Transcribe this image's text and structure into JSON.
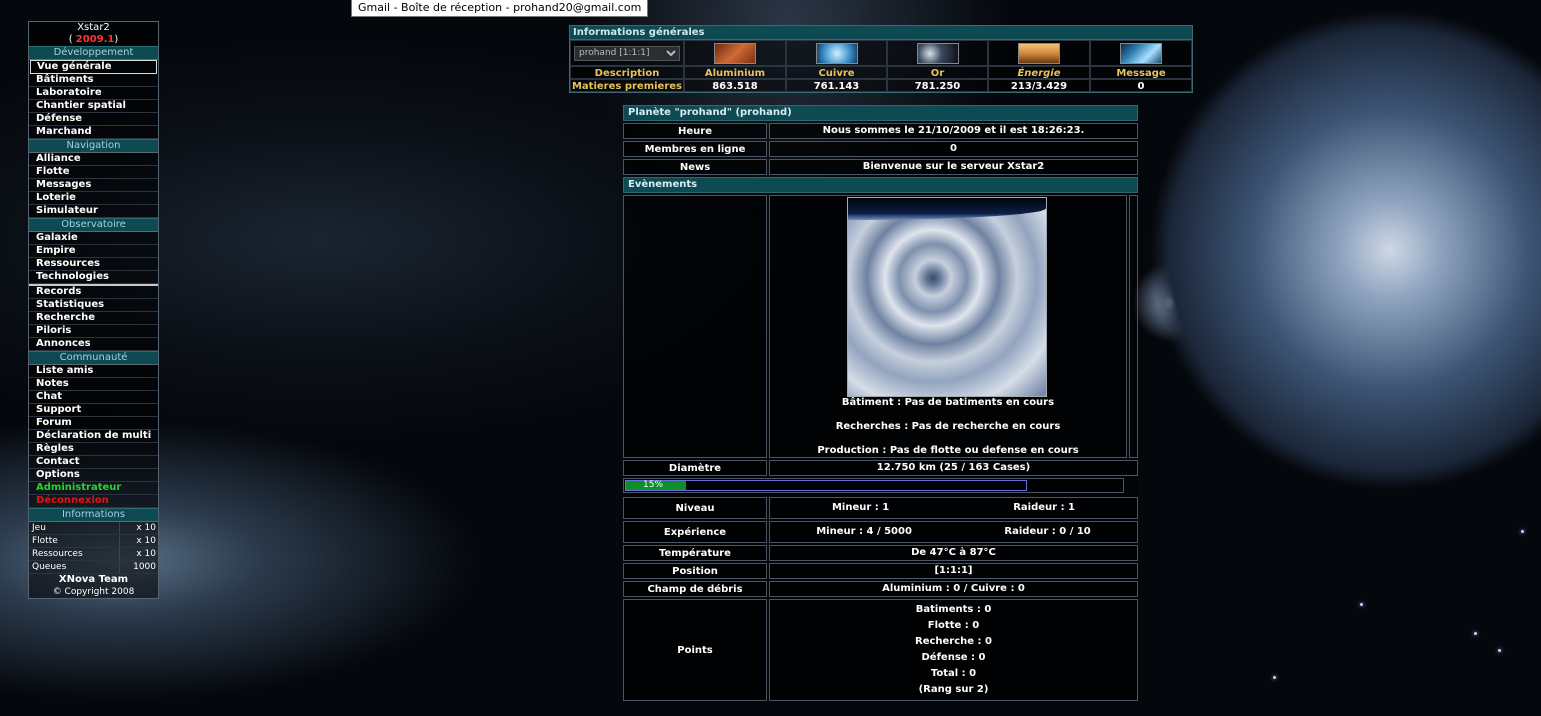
{
  "tooltip": "Gmail - Boîte de réception - prohand20@gmail.com",
  "menu": {
    "server": "Xstar2",
    "version_open": "(",
    "version": "2009.1",
    "version_close": ")",
    "sections": {
      "dev": "Développement",
      "nav": "Navigation",
      "obs": "Observatoire",
      "comm": "Communauté",
      "info": "Informations"
    },
    "dev_items": [
      "Vue générale",
      "Bâtiments",
      "Laboratoire",
      "Chantier spatial",
      "Défense",
      "Marchand"
    ],
    "nav_items": [
      "Alliance",
      "Flotte",
      "Messages",
      "Loterie",
      "Simulateur"
    ],
    "obs_items": [
      "Galaxie",
      "Empire",
      "Ressources",
      "Technologies"
    ],
    "misc_items": [
      "Records",
      "Statistiques",
      "Recherche",
      "Piloris",
      "Annonces"
    ],
    "comm_items": [
      "Liste amis",
      "Notes",
      "Chat",
      "Support",
      "Forum",
      "Déclaration de multi",
      "Règles",
      "Contact",
      "Options"
    ],
    "admin": "Administrateur",
    "logout": "Déconnexion",
    "info_rows": [
      {
        "label": "Jeu",
        "value": "x 10"
      },
      {
        "label": "Flotte",
        "value": "x 10"
      },
      {
        "label": "Ressources",
        "value": "x 10"
      },
      {
        "label": "Queues",
        "value": "1000"
      }
    ],
    "team": "XNova Team",
    "copyright": "© Copyright 2008"
  },
  "general": {
    "title": "Informations générales",
    "planet_select": "prohand [1:1:1]",
    "labels": [
      "Description",
      "Aluminium",
      "Cuivre",
      "Or",
      "Énergie",
      "Message"
    ],
    "values": [
      "Matieres premieres",
      "863.518",
      "761.143",
      "781.250",
      "213/3.429",
      "0"
    ],
    "icon_names": [
      "aluminium-icon",
      "cuivre-icon",
      "or-icon",
      "energie-icon",
      "message-icon"
    ],
    "icon_colors": [
      "#b8552a",
      "#3d8fc9",
      "#7d8ea8",
      "#d0883a",
      "#2e7fb0"
    ]
  },
  "planet": {
    "title": "Planète \"prohand\" (prohand)",
    "time_label": "Heure",
    "time_value": "Nous sommes le 21/10/2009 et il est 18:26:23.",
    "members_label": "Membres en ligne",
    "members_value": "0",
    "news_label": "News",
    "news_value": "Bienvenue sur le serveur Xstar2",
    "events_title": "Evènements",
    "building": "Bâtiment : Pas de batiments en cours",
    "research": "Recherches : Pas de recherche en cours",
    "production": "Production : Pas de flotte ou defense en cours",
    "diameter_label": "Diamètre",
    "diameter_value": "12.750 km (25 / 163 Cases)",
    "progress_percent": 15,
    "progress_text": "15%",
    "level_label": "Niveau",
    "level_miner": "Mineur : 1",
    "level_raider": "Raideur : 1",
    "xp_label": "Expérience",
    "xp_miner": "Mineur : 4 / 5000",
    "xp_raider": "Raideur : 0 / 10",
    "temp_label": "Température",
    "temp_value": "De 47°C à 87°C",
    "pos_label": "Position",
    "pos_value": "[1:1:1]",
    "debris_label": "Champ de débris",
    "debris_value": "Aluminium : 0 / Cuivre : 0",
    "points_label": "Points",
    "points_lines": [
      "Batiments : 0",
      "Flotte : 0",
      "Recherche : 0",
      "Défense : 0",
      "Total : 0",
      "(Rang sur 2)"
    ]
  }
}
